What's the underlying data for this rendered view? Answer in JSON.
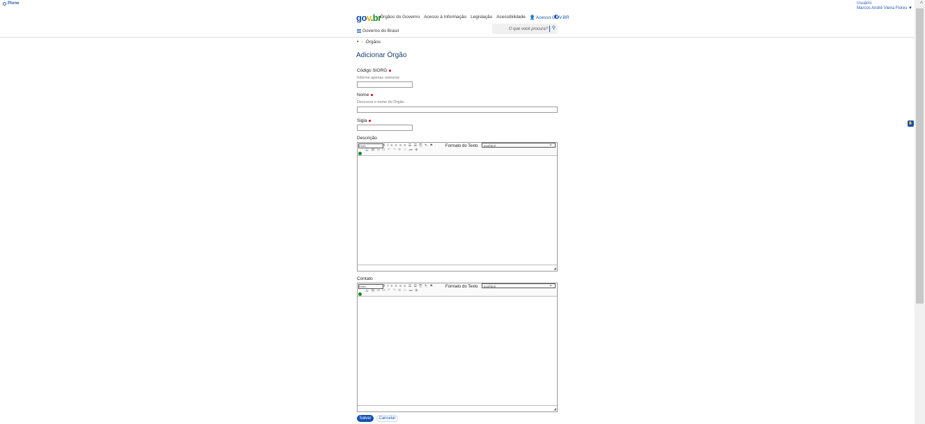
{
  "toolbar": {
    "plone_label": "Plone"
  },
  "user": {
    "label": "Usuário:",
    "name": "Marcos André Vieira Flores"
  },
  "header": {
    "logo": {
      "part1": "go",
      "part2": "v",
      "part3": ".br"
    },
    "links": [
      "Órgãos do Governo",
      "Acesso à Informação",
      "Legislação",
      "Acessibilidade"
    ],
    "govbr_login": "Acesso GOV.BR",
    "menu_label": "Governo do Brasil",
    "search_placeholder": "O que você procura?"
  },
  "breadcrumb": {
    "home": "•",
    "items": [
      "Órgãos"
    ]
  },
  "form": {
    "title": "Adicionar Órgão",
    "codigo": {
      "label": "Código SIORG",
      "help": "Informe apenas números"
    },
    "nome": {
      "label": "Nome",
      "help": "Descreva o nome do Órgão."
    },
    "sigla": {
      "label": "Sigla"
    },
    "descricao": {
      "label": "Descrição",
      "format_label": "Formato do Texto",
      "format_value": "text/html",
      "style_value": "Estilo"
    },
    "contato": {
      "label": "Contato",
      "format_label": "Formato do Texto",
      "format_value": "text/html",
      "style_value": "Estilo"
    },
    "save_label": "Salvar",
    "cancel_label": "Cancelar"
  },
  "icons": {
    "user": "user-icon",
    "contrast": "contrast-icon",
    "search": "search-icon",
    "menu": "hamburger-icon"
  },
  "colors": {
    "primary": "#1351b4",
    "required": "#d40000"
  }
}
